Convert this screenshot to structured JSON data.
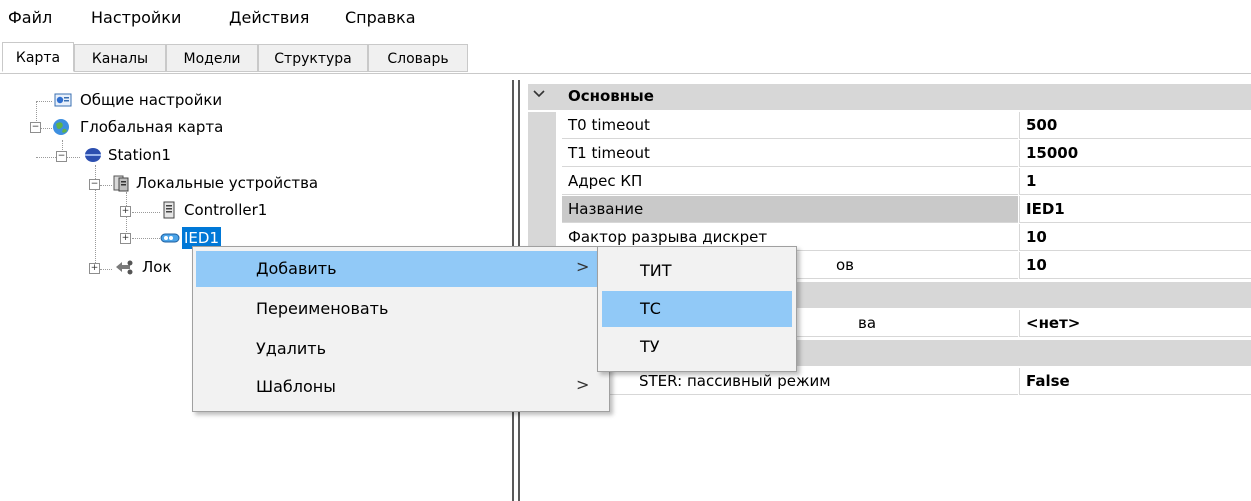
{
  "menubar": {
    "items": [
      "Файл",
      "Настройки",
      "Действия",
      "Справка"
    ]
  },
  "tabs": [
    "Карта",
    "Каналы",
    "Модели",
    "Структура",
    "Словарь"
  ],
  "active_tab": "Карта",
  "tree": {
    "nodes": [
      {
        "label": "Общие настройки",
        "icon": "settings-icon"
      },
      {
        "label": "Глобальная карта",
        "icon": "globe-icon"
      },
      {
        "label": "Station1",
        "icon": "station-icon"
      },
      {
        "label": "Локальные устройства",
        "icon": "devices-icon"
      },
      {
        "label": "Controller1",
        "icon": "controller-icon"
      },
      {
        "label": "IED1",
        "icon": "ied-icon",
        "selected": true
      },
      {
        "label": "Лок",
        "icon": "network-icon"
      }
    ]
  },
  "propgrid": {
    "category": "Основные",
    "rows": [
      {
        "name": "T0 timeout",
        "value": "500"
      },
      {
        "name": "T1 timeout",
        "value": "15000"
      },
      {
        "name": "Адрес КП",
        "value": "1"
      },
      {
        "name": "Название",
        "value": "IED1"
      },
      {
        "name": "Фактор разрыва дискрет",
        "value": "10"
      },
      {
        "name": "ов",
        "value": "10"
      },
      {
        "name": "ва",
        "value": "<нет>"
      },
      {
        "name": "STER: пассивный режим",
        "value": "False"
      }
    ]
  },
  "context_menu": {
    "items": [
      {
        "label": "Добавить",
        "has_submenu": true,
        "highlighted": true
      },
      {
        "label": "Переименовать",
        "has_submenu": false
      },
      {
        "label": "Удалить",
        "has_submenu": false
      },
      {
        "label": "Шаблоны",
        "has_submenu": true
      }
    ],
    "arrow": ">"
  },
  "submenu": {
    "items": [
      "ТИТ",
      "ТС",
      "ТУ"
    ],
    "highlighted": "ТС"
  },
  "colors": {
    "highlight": "#91c9f7",
    "selection": "#0078d7",
    "category_bg": "#d7d7d7"
  }
}
